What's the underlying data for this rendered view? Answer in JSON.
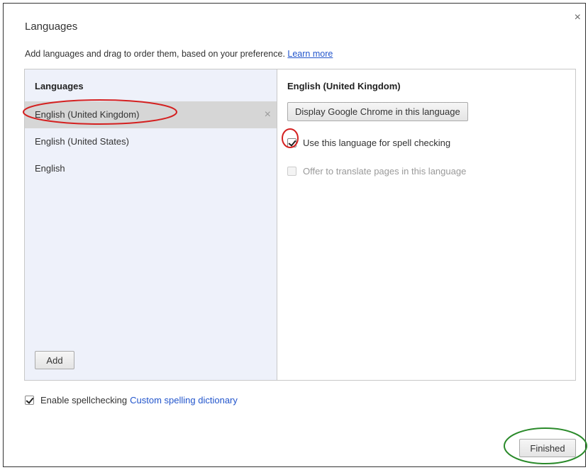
{
  "dialog": {
    "title": "Languages",
    "close_glyph": "×",
    "description": "Add languages and drag to order them, based on your preference.",
    "learn_more": "Learn more"
  },
  "left_panel": {
    "header": "Languages",
    "items": [
      {
        "label": "English (United Kingdom)",
        "selected": true,
        "remove_glyph": "×"
      },
      {
        "label": "English (United States)",
        "selected": false
      },
      {
        "label": "English",
        "selected": false
      }
    ],
    "add_label": "Add"
  },
  "right_panel": {
    "header": "English (United Kingdom)",
    "display_button_label": "Display Google Chrome in this language",
    "spellcheck_option": {
      "label": "Use this language for spell checking",
      "checked": true
    },
    "translate_option": {
      "label": "Offer to translate pages in this language",
      "checked": false,
      "disabled": true
    }
  },
  "bottom": {
    "enable_spellcheck_label": "Enable spellchecking",
    "enable_spellcheck_checked": true,
    "custom_dictionary_link": "Custom spelling dictionary",
    "finished_label": "Finished"
  },
  "colors": {
    "link": "#2255cc",
    "selected_row": "#d6d6d6",
    "left_panel_bg": "#eef1fa",
    "annotation_red": "#d42020",
    "annotation_green": "#2a8a2a"
  },
  "icons": {
    "close": "close-icon",
    "remove": "remove-icon",
    "checkbox": "checkbox-icon"
  }
}
